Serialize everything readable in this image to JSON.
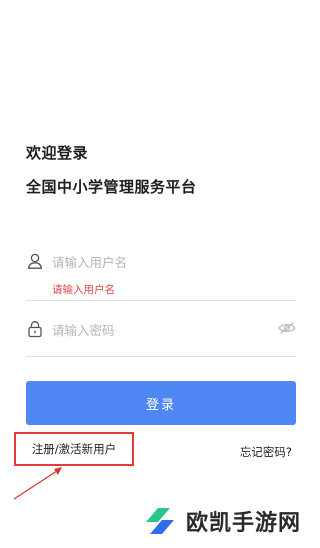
{
  "header": {
    "welcome": "欢迎登录",
    "platform": "全国中小学管理服务平台"
  },
  "form": {
    "username_placeholder": "请输入用户名",
    "username_error": "请输入用户名",
    "password_placeholder": "请输入密码",
    "login_label": "登录"
  },
  "links": {
    "register": "注册/激活新用户",
    "forgot_password": "忘记密码?"
  },
  "watermark": {
    "name": "欧凯手游网"
  },
  "colors": {
    "primary": "#4f88f4",
    "error": "#e04b4b",
    "highlight_box": "#e23b3b",
    "logo_green": "#2bc48a",
    "logo_blue": "#2f6ee8"
  }
}
